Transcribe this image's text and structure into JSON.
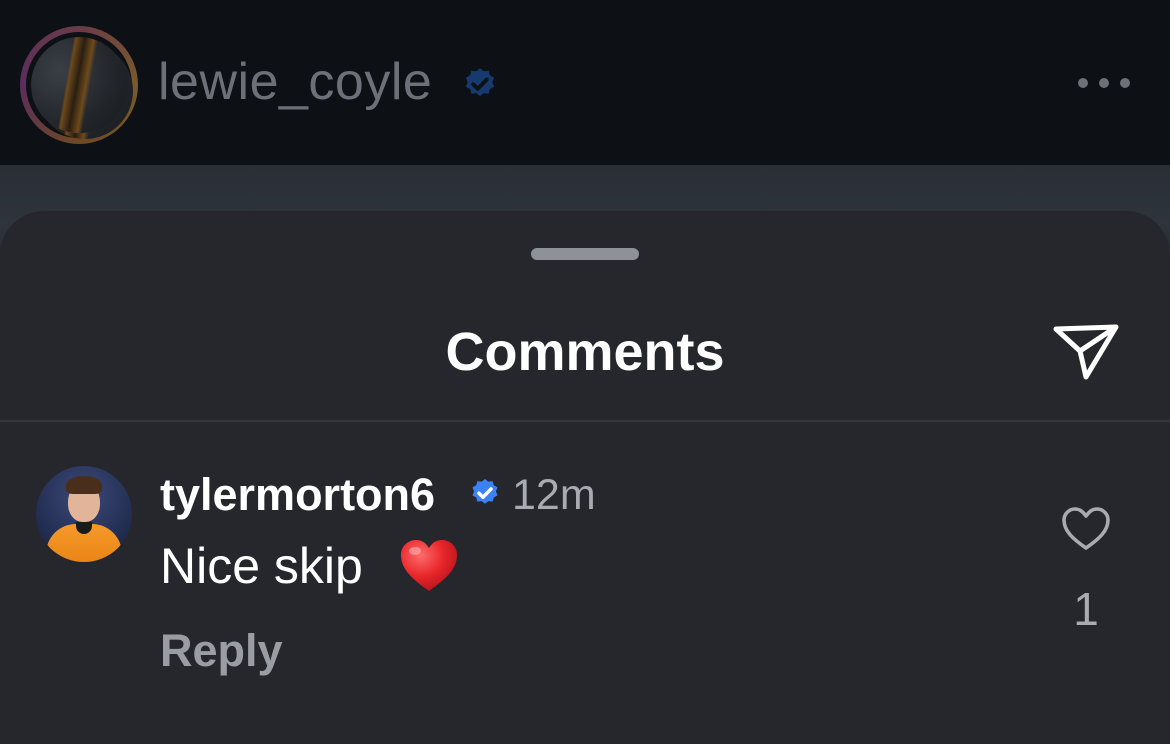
{
  "post": {
    "author_username": "lewie_coyle",
    "author_verified": true
  },
  "comments_sheet": {
    "title": "Comments",
    "comments": [
      {
        "username": "tylermorton6",
        "verified": true,
        "time": "12m",
        "text": "Nice skip",
        "emoji": "red-heart",
        "reply_label": "Reply",
        "like_count": "1"
      }
    ]
  },
  "colors": {
    "sheet_background": "#25272c",
    "verified_blue": "#3b82f6",
    "secondary_text": "#a8abb1"
  },
  "icons": [
    "verified-badge-icon",
    "more-icon",
    "share-icon",
    "heart-emoji",
    "like-heart-icon"
  ]
}
